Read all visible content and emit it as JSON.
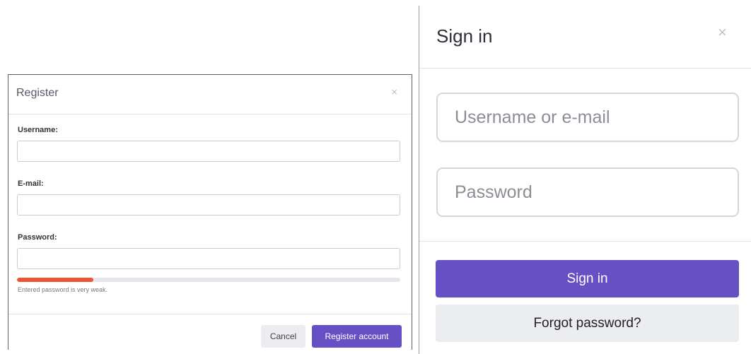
{
  "register": {
    "title": "Register",
    "close_icon": "×",
    "username_label": "Username:",
    "email_label": "E-mail:",
    "password_label": "Password:",
    "strength_fraction": 0.2,
    "strength_color": "#f0522f",
    "strength_message": "Entered password is very weak.",
    "cancel_label": "Cancel",
    "submit_label": "Register account"
  },
  "signin": {
    "title": "Sign in",
    "close_icon": "×",
    "username_placeholder": "Username or e-mail",
    "password_placeholder": "Password",
    "submit_label": "Sign in",
    "forgot_label": "Forgot password?"
  },
  "colors": {
    "accent": "#6650c4",
    "secondary_button": "#ecedf0"
  }
}
